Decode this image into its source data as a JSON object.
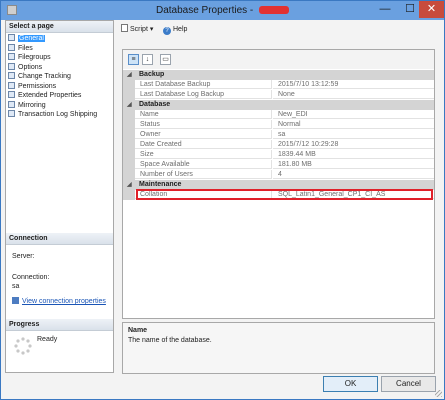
{
  "window": {
    "title": "Database Properties - ",
    "redacted_suffix": "",
    "minimize_glyph": "—",
    "maximize_glyph": "☐",
    "close_glyph": "✕"
  },
  "left": {
    "select_page_label": "Select a page",
    "pages": [
      "General",
      "Files",
      "Filegroups",
      "Options",
      "Change Tracking",
      "Permissions",
      "Extended Properties",
      "Mirroring",
      "Transaction Log Shipping"
    ],
    "selected_page": "General",
    "connection_label": "Connection",
    "server_label": "Server:",
    "connection_label_text": "Connection:",
    "connection_value": "sa",
    "view_connection_link": "View connection properties",
    "progress_label": "Progress",
    "progress_status": "Ready"
  },
  "toolbar": {
    "script_label": "Script",
    "help_label": "Help"
  },
  "grid": {
    "categories": [
      {
        "name": "Backup",
        "rows": [
          {
            "name": "Last Database Backup",
            "value": "2015/7/10 13:12:59"
          },
          {
            "name": "Last Database Log Backup",
            "value": "None"
          }
        ]
      },
      {
        "name": "Database",
        "rows": [
          {
            "name": "Name",
            "value": "New_EDI"
          },
          {
            "name": "Status",
            "value": "Normal"
          },
          {
            "name": "Owner",
            "value": "sa"
          },
          {
            "name": "Date Created",
            "value": "2015/7/12 10:29:28"
          },
          {
            "name": "Size",
            "value": "1839.44 MB"
          },
          {
            "name": "Space Available",
            "value": "181.80 MB"
          },
          {
            "name": "Number of Users",
            "value": "4"
          }
        ]
      },
      {
        "name": "Maintenance",
        "rows": [
          {
            "name": "Collation",
            "value": "SQL_Latin1_General_CP1_CI_AS"
          }
        ]
      }
    ]
  },
  "description": {
    "title": "Name",
    "text": "The name of the database."
  },
  "footer": {
    "ok_label": "OK",
    "cancel_label": "Cancel"
  },
  "colors": {
    "highlight": "#e0212a",
    "selection": "#3399ff",
    "titlebar": "#6aa0e0"
  }
}
